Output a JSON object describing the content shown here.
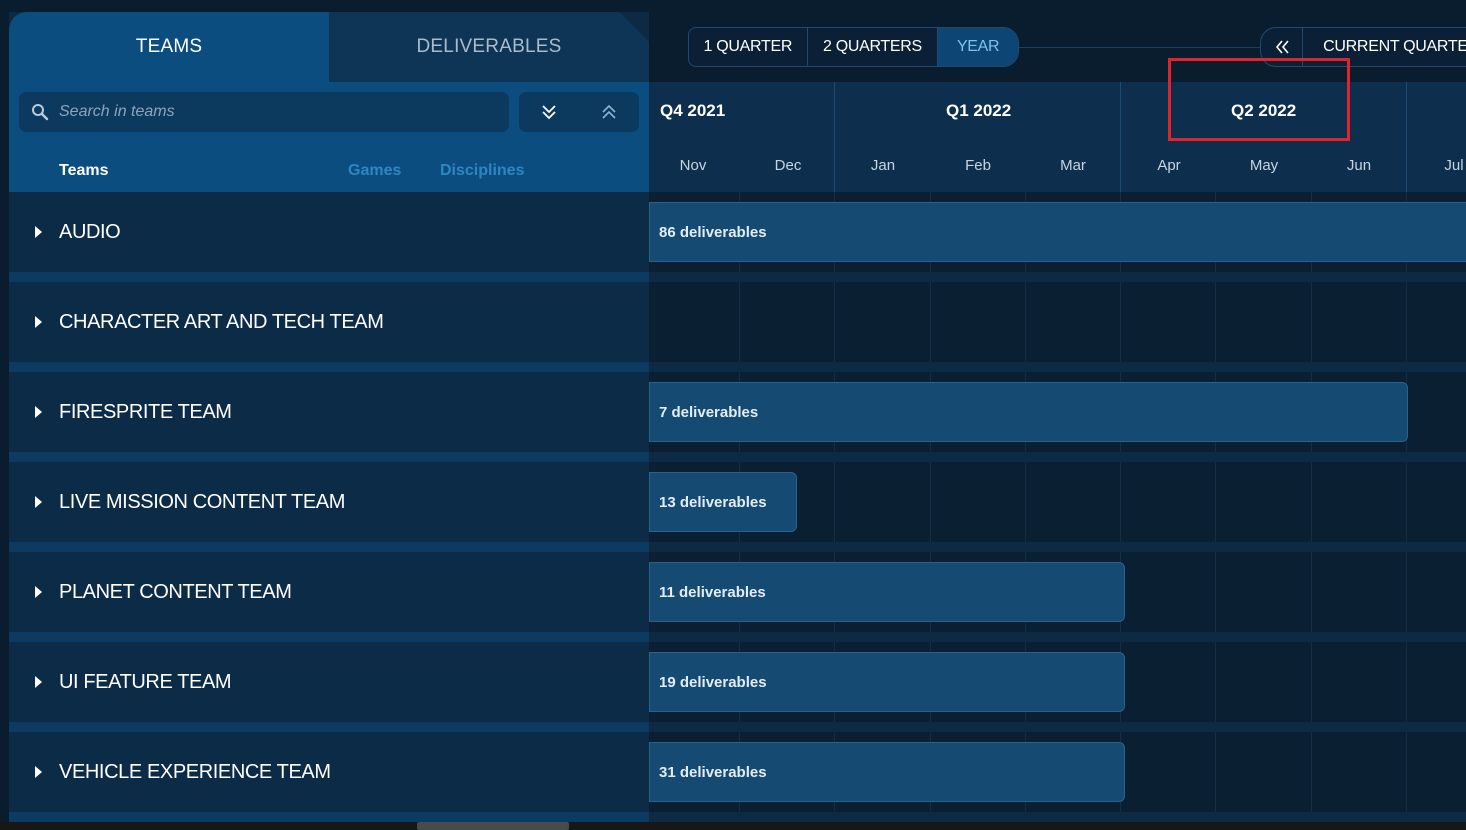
{
  "tabs": {
    "teams": "TEAMS",
    "deliverables": "DELIVERABLES"
  },
  "search": {
    "placeholder": "Search in teams"
  },
  "subtabs": {
    "teams": "Teams",
    "games": "Games",
    "disciplines": "Disciplines"
  },
  "zoom": {
    "one_quarter": "1 QUARTER",
    "two_quarters": "2 QUARTERS",
    "year": "YEAR",
    "selected": "YEAR"
  },
  "nav": {
    "prev_icon": "double-chevron-left-icon",
    "current": "CURRENT QUARTER"
  },
  "timeline": {
    "quarters": [
      "Q4 2021",
      "Q1 2022",
      "Q2 2022"
    ],
    "months": [
      "Nov",
      "Dec",
      "Jan",
      "Feb",
      "Mar",
      "Apr",
      "May",
      "Jun",
      "Jul"
    ],
    "highlighted_quarter": "Q2 2022"
  },
  "teams": [
    {
      "name": "AUDIO",
      "deliverables": "86 deliverables"
    },
    {
      "name": "CHARACTER ART AND TECH TEAM",
      "deliverables": ""
    },
    {
      "name": "FIRESPRITE TEAM",
      "deliverables": "7 deliverables"
    },
    {
      "name": "LIVE MISSION CONTENT TEAM",
      "deliverables": "13 deliverables"
    },
    {
      "name": "PLANET CONTENT TEAM",
      "deliverables": "11 deliverables"
    },
    {
      "name": "UI FEATURE TEAM",
      "deliverables": "19 deliverables"
    },
    {
      "name": "VEHICLE EXPERIENCE TEAM",
      "deliverables": "31 deliverables"
    }
  ],
  "colors": {
    "accent": "#0c4d80",
    "link": "#2d86c4",
    "highlight": "#e1232c"
  }
}
